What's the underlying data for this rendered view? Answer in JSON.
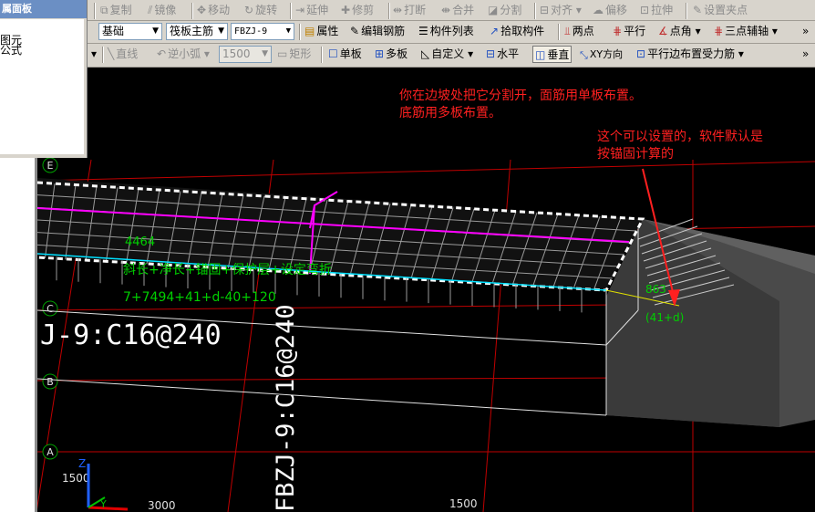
{
  "panel": {
    "title": "属面板",
    "items": [
      "图元",
      "公式"
    ]
  },
  "toolbar1": {
    "copy": "复制",
    "mirror": "镜像",
    "move": "移动",
    "rotate": "旋转",
    "extend": "延伸",
    "trim": "修剪",
    "break": "打断",
    "merge": "合并",
    "split": "分割",
    "align": "对齐",
    "offset": "偏移",
    "stretch": "拉伸",
    "set_grip": "设置夹点"
  },
  "toolbar2": {
    "floor": "基础",
    "component_type": "筏板主筋",
    "component_name": "FBZJ-9",
    "properties": "属性",
    "edit_rebar": "编辑钢筋",
    "component_list": "构件列表",
    "pick": "拾取构件",
    "two_point": "两点",
    "parallel": "平行",
    "point_angle": "点角",
    "three_point_aux": "三点辅轴",
    "more": "»"
  },
  "toolbar3": {
    "line": "直线",
    "arc": "逆小弧",
    "radius": "1500",
    "rect": "矩形",
    "single_slab": "单板",
    "multi_slab": "多板",
    "custom": "自定义",
    "horizontal": "水平",
    "vertical": "垂直",
    "xy_dir": "XY方向",
    "parallel_edge": "平行边布置受力筋",
    "more": "»"
  },
  "annotations": {
    "note1": [
      "你在边坡处把它分割开，面筋用单板布置。",
      "底筋用多板布置。"
    ],
    "note2": [
      "这个可以设置的，软件默认是",
      "按锚固计算的"
    ]
  },
  "scene": {
    "axis_labels": [
      "E",
      "D",
      "C",
      "B",
      "A"
    ],
    "rebar_label_h": "J-9:C16@240",
    "rebar_label_v": "FBZJ-9:C16@240",
    "length_value": "4464",
    "formula_text": "斜长+净长+锚固+保护层+设定弯折",
    "formula_value": "7+7494+41+d-40+120",
    "slope_value": "863",
    "slope_formula": "(41+d)",
    "dim_1500_left": "1500",
    "dim_3000": "3000",
    "dim_1500_bottom": "1500",
    "z_axis": "Z",
    "y_axis": "Y"
  },
  "colors": {
    "grid_red": "#c00000",
    "rebar_green": "#00d000",
    "magenta": "#ff00ff",
    "cyan": "#00e0ff",
    "annotation_red": "#ff2020",
    "toolbar_bg": "#d8d4cc"
  }
}
